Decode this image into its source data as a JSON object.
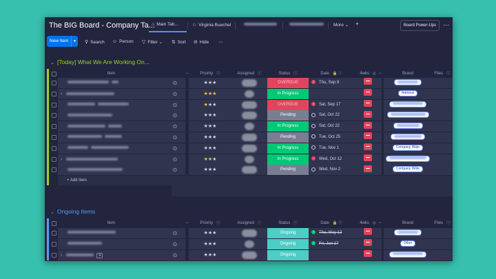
{
  "app": {
    "board_title": "The BIG Board - Company Ta...",
    "tabs": [
      {
        "label": "Main Tab..."
      },
      {
        "label": "Virginia Buechel"
      },
      {
        "label": ""
      },
      {
        "label": ""
      }
    ],
    "more_label": "More",
    "add_tab": "+",
    "power_ups": "Board Power-Ups",
    "menu_dots": "⋯"
  },
  "toolbar": {
    "new_item": "New Item",
    "search": "Search",
    "person": "Person",
    "filter": "Filter",
    "sort": "Sort",
    "hide": "Hide",
    "more": "⋯"
  },
  "columns": {
    "item": "Item",
    "priority": "Priority",
    "assigned": "Assigned",
    "status": "Status",
    "date": "Date",
    "wks": "4wks",
    "brand": "Brand",
    "files": "Files"
  },
  "groups": [
    {
      "title": "[Today] What We Are Working On...",
      "color": "#9cd326",
      "add_item": "+ Add Item",
      "rows": [
        {
          "priority_filled": 0,
          "status": "OVERDUE",
          "status_color": "#e2445c",
          "status_text_color": "#f4c3cb",
          "date_icon": "err",
          "date": "Thu, Sep 8",
          "strike": false,
          "brand": ""
        },
        {
          "priority_filled": 3,
          "status": "In Progress",
          "status_color": "#00c875",
          "status_text_color": "#ffffff",
          "date_icon": "none",
          "date": "",
          "strike": false,
          "brand": "National"
        },
        {
          "priority_filled": 1,
          "status": "OVERDUE",
          "status_color": "#e2445c",
          "status_text_color": "#f4c3cb",
          "date_icon": "err",
          "date": "Sat, Sep 17",
          "strike": false,
          "brand": ""
        },
        {
          "priority_filled": 0,
          "status": "Pending",
          "status_color": "#797e93",
          "status_text_color": "#ffffff",
          "date_icon": "open",
          "date": "Sat, Oct 22",
          "strike": false,
          "brand": ""
        },
        {
          "priority_filled": 0,
          "status": "In Progress",
          "status_color": "#00c875",
          "status_text_color": "#ffffff",
          "date_icon": "open",
          "date": "Sat, Oct 22",
          "strike": false,
          "brand": ""
        },
        {
          "priority_filled": 0,
          "status": "Pending",
          "status_color": "#797e93",
          "status_text_color": "#ffffff",
          "date_icon": "open",
          "date": "Tue, Oct 25",
          "strike": false,
          "brand": ""
        },
        {
          "priority_filled": 0,
          "status": "In Progress",
          "status_color": "#00c875",
          "status_text_color": "#ffffff",
          "date_icon": "open",
          "date": "Tue, Nov 1",
          "strike": false,
          "brand": "Company Wide"
        },
        {
          "priority_filled": 2,
          "status": "In Progress",
          "status_color": "#00c875",
          "status_text_color": "#ffffff",
          "date_icon": "err",
          "date": "Wed, Oct 12",
          "strike": false,
          "brand": ""
        },
        {
          "priority_filled": 0,
          "status": "Pending",
          "status_color": "#797e93",
          "status_text_color": "#ffffff",
          "date_icon": "open",
          "date": "Wed, Nov 2",
          "strike": false,
          "brand": "Company Wide"
        }
      ]
    },
    {
      "title": "Ongoing Items",
      "color": "#579bfc",
      "rows": [
        {
          "priority_filled": 0,
          "status": "Ongoing",
          "status_color": "#4eccc6",
          "status_text_color": "#ffffff",
          "date_icon": "ok",
          "date": "Thu, May 12",
          "strike": true,
          "brand": ""
        },
        {
          "priority_filled": 0,
          "status": "Ongoing",
          "status_color": "#4eccc6",
          "status_text_color": "#ffffff",
          "date_icon": "ok",
          "date": "Fri, Jun 17",
          "strike": true,
          "brand": "Other"
        },
        {
          "priority_filled": 0,
          "status": "Ongoing",
          "status_color": "#4eccc6",
          "status_text_color": "#ffffff",
          "date_icon": "none",
          "date": "",
          "strike": false,
          "brand": "",
          "subitems": "4"
        }
      ]
    }
  ]
}
